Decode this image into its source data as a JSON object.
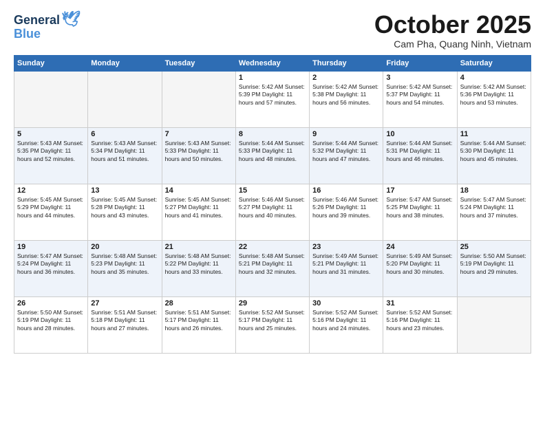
{
  "logo": {
    "line1": "General",
    "line2": "Blue"
  },
  "header": {
    "month": "October 2025",
    "location": "Cam Pha, Quang Ninh, Vietnam"
  },
  "weekdays": [
    "Sunday",
    "Monday",
    "Tuesday",
    "Wednesday",
    "Thursday",
    "Friday",
    "Saturday"
  ],
  "weeks": [
    [
      {
        "day": "",
        "info": ""
      },
      {
        "day": "",
        "info": ""
      },
      {
        "day": "",
        "info": ""
      },
      {
        "day": "1",
        "info": "Sunrise: 5:42 AM\nSunset: 5:39 PM\nDaylight: 11 hours and 57 minutes."
      },
      {
        "day": "2",
        "info": "Sunrise: 5:42 AM\nSunset: 5:38 PM\nDaylight: 11 hours and 56 minutes."
      },
      {
        "day": "3",
        "info": "Sunrise: 5:42 AM\nSunset: 5:37 PM\nDaylight: 11 hours and 54 minutes."
      },
      {
        "day": "4",
        "info": "Sunrise: 5:42 AM\nSunset: 5:36 PM\nDaylight: 11 hours and 53 minutes."
      }
    ],
    [
      {
        "day": "5",
        "info": "Sunrise: 5:43 AM\nSunset: 5:35 PM\nDaylight: 11 hours and 52 minutes."
      },
      {
        "day": "6",
        "info": "Sunrise: 5:43 AM\nSunset: 5:34 PM\nDaylight: 11 hours and 51 minutes."
      },
      {
        "day": "7",
        "info": "Sunrise: 5:43 AM\nSunset: 5:33 PM\nDaylight: 11 hours and 50 minutes."
      },
      {
        "day": "8",
        "info": "Sunrise: 5:44 AM\nSunset: 5:33 PM\nDaylight: 11 hours and 48 minutes."
      },
      {
        "day": "9",
        "info": "Sunrise: 5:44 AM\nSunset: 5:32 PM\nDaylight: 11 hours and 47 minutes."
      },
      {
        "day": "10",
        "info": "Sunrise: 5:44 AM\nSunset: 5:31 PM\nDaylight: 11 hours and 46 minutes."
      },
      {
        "day": "11",
        "info": "Sunrise: 5:44 AM\nSunset: 5:30 PM\nDaylight: 11 hours and 45 minutes."
      }
    ],
    [
      {
        "day": "12",
        "info": "Sunrise: 5:45 AM\nSunset: 5:29 PM\nDaylight: 11 hours and 44 minutes."
      },
      {
        "day": "13",
        "info": "Sunrise: 5:45 AM\nSunset: 5:28 PM\nDaylight: 11 hours and 43 minutes."
      },
      {
        "day": "14",
        "info": "Sunrise: 5:45 AM\nSunset: 5:27 PM\nDaylight: 11 hours and 41 minutes."
      },
      {
        "day": "15",
        "info": "Sunrise: 5:46 AM\nSunset: 5:27 PM\nDaylight: 11 hours and 40 minutes."
      },
      {
        "day": "16",
        "info": "Sunrise: 5:46 AM\nSunset: 5:26 PM\nDaylight: 11 hours and 39 minutes."
      },
      {
        "day": "17",
        "info": "Sunrise: 5:47 AM\nSunset: 5:25 PM\nDaylight: 11 hours and 38 minutes."
      },
      {
        "day": "18",
        "info": "Sunrise: 5:47 AM\nSunset: 5:24 PM\nDaylight: 11 hours and 37 minutes."
      }
    ],
    [
      {
        "day": "19",
        "info": "Sunrise: 5:47 AM\nSunset: 5:24 PM\nDaylight: 11 hours and 36 minutes."
      },
      {
        "day": "20",
        "info": "Sunrise: 5:48 AM\nSunset: 5:23 PM\nDaylight: 11 hours and 35 minutes."
      },
      {
        "day": "21",
        "info": "Sunrise: 5:48 AM\nSunset: 5:22 PM\nDaylight: 11 hours and 33 minutes."
      },
      {
        "day": "22",
        "info": "Sunrise: 5:48 AM\nSunset: 5:21 PM\nDaylight: 11 hours and 32 minutes."
      },
      {
        "day": "23",
        "info": "Sunrise: 5:49 AM\nSunset: 5:21 PM\nDaylight: 11 hours and 31 minutes."
      },
      {
        "day": "24",
        "info": "Sunrise: 5:49 AM\nSunset: 5:20 PM\nDaylight: 11 hours and 30 minutes."
      },
      {
        "day": "25",
        "info": "Sunrise: 5:50 AM\nSunset: 5:19 PM\nDaylight: 11 hours and 29 minutes."
      }
    ],
    [
      {
        "day": "26",
        "info": "Sunrise: 5:50 AM\nSunset: 5:19 PM\nDaylight: 11 hours and 28 minutes."
      },
      {
        "day": "27",
        "info": "Sunrise: 5:51 AM\nSunset: 5:18 PM\nDaylight: 11 hours and 27 minutes."
      },
      {
        "day": "28",
        "info": "Sunrise: 5:51 AM\nSunset: 5:17 PM\nDaylight: 11 hours and 26 minutes."
      },
      {
        "day": "29",
        "info": "Sunrise: 5:52 AM\nSunset: 5:17 PM\nDaylight: 11 hours and 25 minutes."
      },
      {
        "day": "30",
        "info": "Sunrise: 5:52 AM\nSunset: 5:16 PM\nDaylight: 11 hours and 24 minutes."
      },
      {
        "day": "31",
        "info": "Sunrise: 5:52 AM\nSunset: 5:16 PM\nDaylight: 11 hours and 23 minutes."
      },
      {
        "day": "",
        "info": ""
      }
    ]
  ]
}
